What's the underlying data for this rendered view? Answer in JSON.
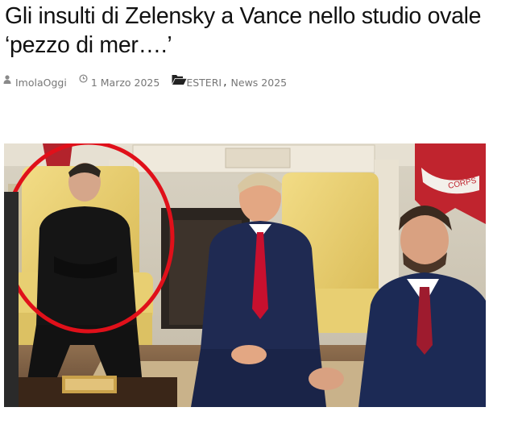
{
  "article": {
    "title_line1": "Gli insulti di Zelensky a Vance nello studio ovale",
    "title_line2": "‘pezzo di mer….’",
    "author": "ImolaOggi",
    "date": "1 Marzo 2025",
    "categories": [
      "ESTERI",
      "News 2025"
    ],
    "category_separator": ","
  },
  "icons": {
    "author": "user-icon",
    "date": "clock-icon",
    "category": "folder-open-icon"
  },
  "photo": {
    "flag_text": "CORPS",
    "highlight_color": "#e0101a"
  }
}
